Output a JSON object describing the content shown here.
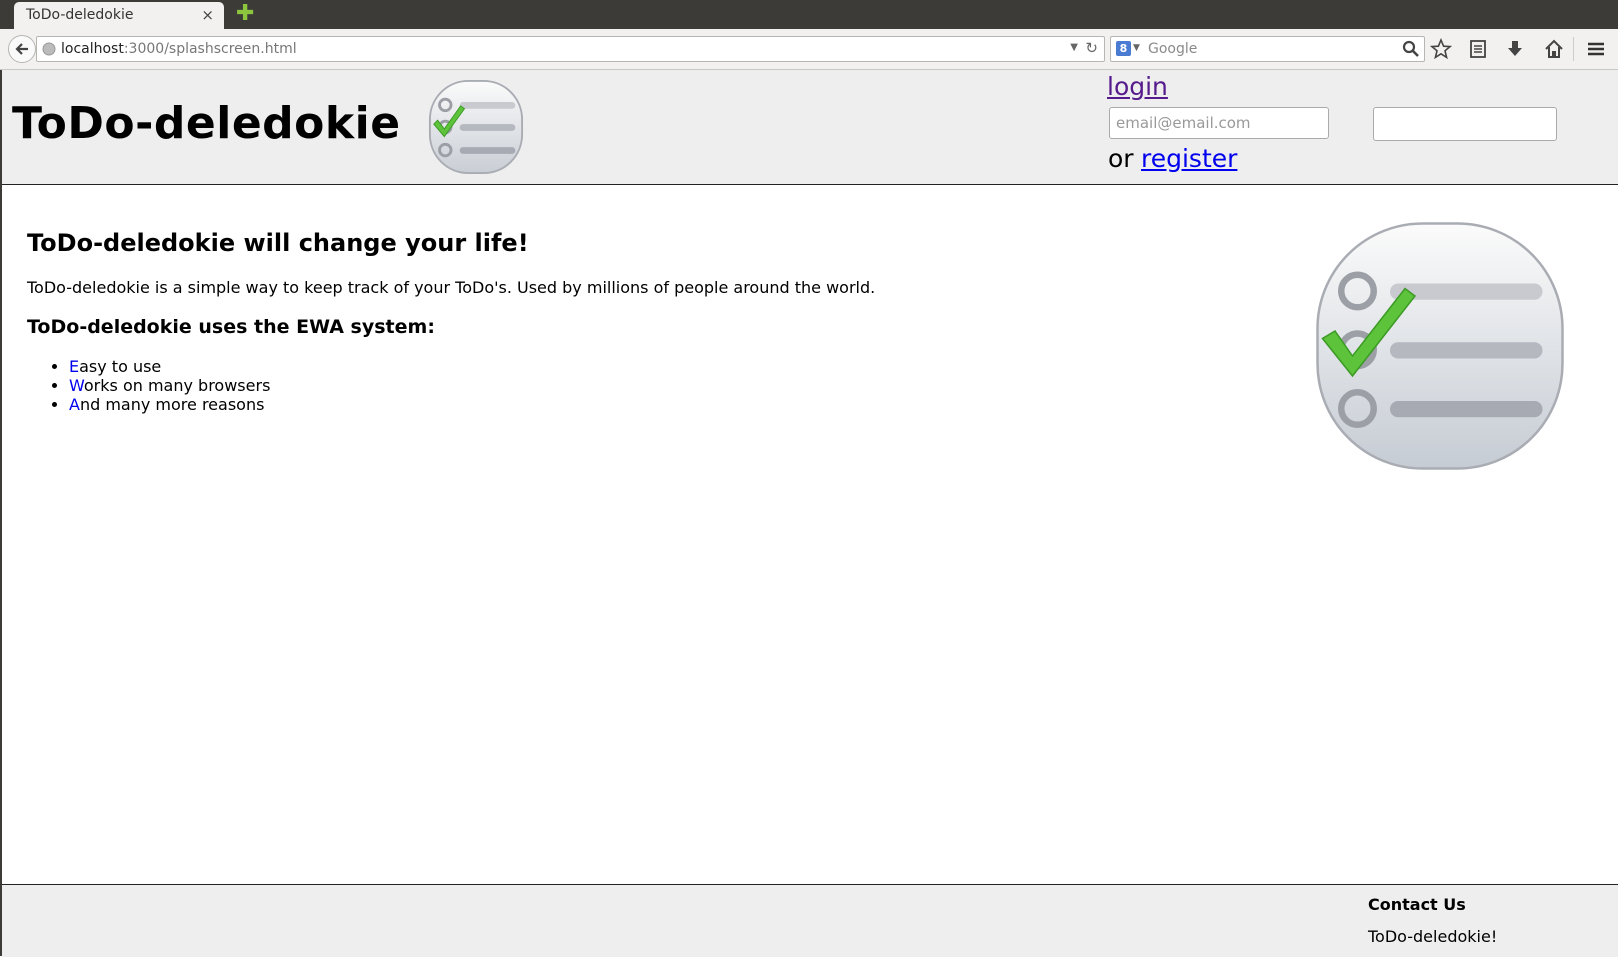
{
  "browser": {
    "tab_title": "ToDo-deledokie",
    "tab_close": "×",
    "new_tab": "✚",
    "url_host": "localhost",
    "url_rest": ":3000/splashscreen.html",
    "search_engine_icon": "8",
    "search_placeholder": "Google"
  },
  "header": {
    "site_title": "ToDo-deledokie",
    "login_link": "login",
    "email_placeholder": "email@email.com",
    "or_text": "or",
    "register_link": "register"
  },
  "main": {
    "headline": "ToDo-deledokie will change your life!",
    "intro": "ToDo-deledokie is a simple way to keep track of your ToDo's. Used by millions of people around the world.",
    "subhead": "ToDo-deledokie uses the EWA system:",
    "features": [
      {
        "first": "E",
        "rest": "asy to use"
      },
      {
        "first": "W",
        "rest": "orks on many browsers"
      },
      {
        "first": "A",
        "rest": "nd many more reasons"
      }
    ]
  },
  "footer": {
    "heading": "Contact Us",
    "text": "ToDo-deledokie!"
  },
  "colors": {
    "visited_link": "#551a8b",
    "link": "#0000ee",
    "header_bg": "#eeeeee",
    "check_green": "#5cc33b"
  }
}
